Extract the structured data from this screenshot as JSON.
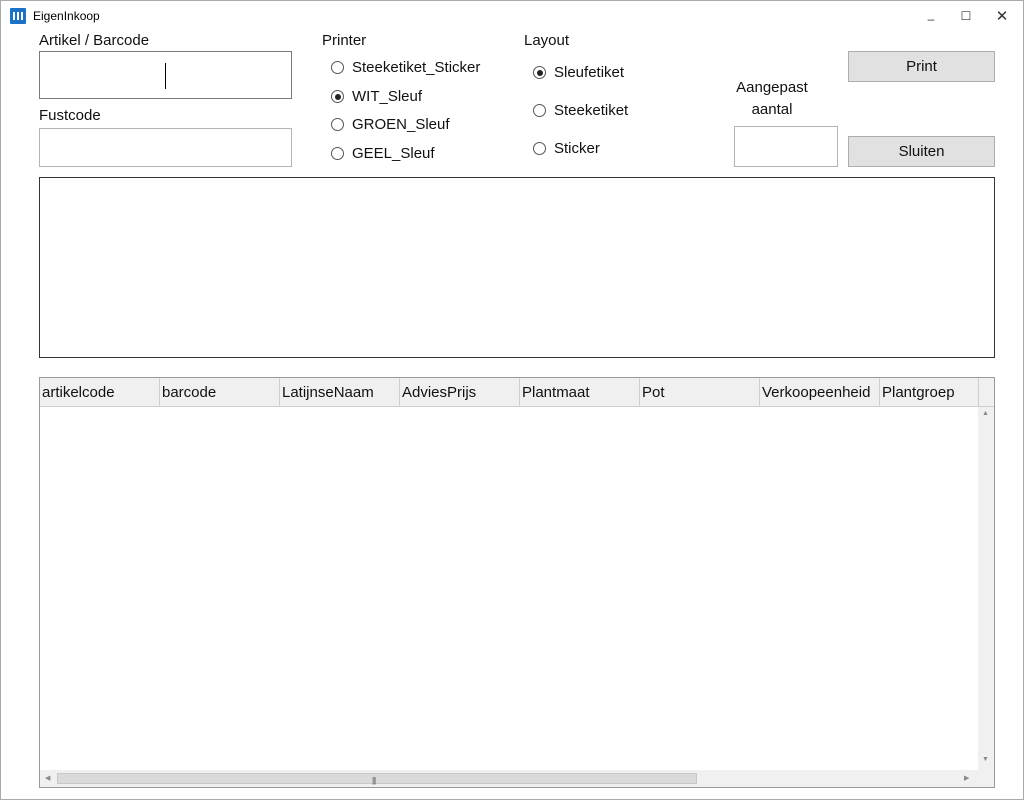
{
  "window": {
    "title": "EigenInkoop",
    "minimize_glyph": "–",
    "maximize_glyph": "☐",
    "close_glyph": "✕"
  },
  "fields": {
    "artikel_label": "Artikel / Barcode",
    "artikel_value": "",
    "fustcode_label": "Fustcode",
    "fustcode_value": "",
    "aangepast_label_line1": "Aangepast",
    "aangepast_label_line2": "aantal",
    "aangepast_value": ""
  },
  "printer": {
    "label": "Printer",
    "options": [
      {
        "label": "Steeketiket_Sticker",
        "checked": false
      },
      {
        "label": "WIT_Sleuf",
        "checked": true
      },
      {
        "label": "GROEN_Sleuf",
        "checked": false
      },
      {
        "label": "GEEL_Sleuf",
        "checked": false
      }
    ]
  },
  "layout": {
    "label": "Layout",
    "options": [
      {
        "label": "Sleufetiket",
        "checked": true
      },
      {
        "label": "Steeketiket",
        "checked": false
      },
      {
        "label": "Sticker",
        "checked": false
      }
    ]
  },
  "buttons": {
    "print": "Print",
    "close": "Sluiten"
  },
  "grid": {
    "columns": [
      "artikelcode",
      "barcode",
      "LatijnseNaam",
      "AdviesPrijs",
      "Plantmaat",
      "Pot",
      "Verkoopeenheid",
      "Plantgroep"
    ],
    "rows": []
  },
  "colors": {
    "app_icon": "#1a73c7",
    "button_bg": "#e1e1e1",
    "header_bg": "#f0f0f0"
  }
}
